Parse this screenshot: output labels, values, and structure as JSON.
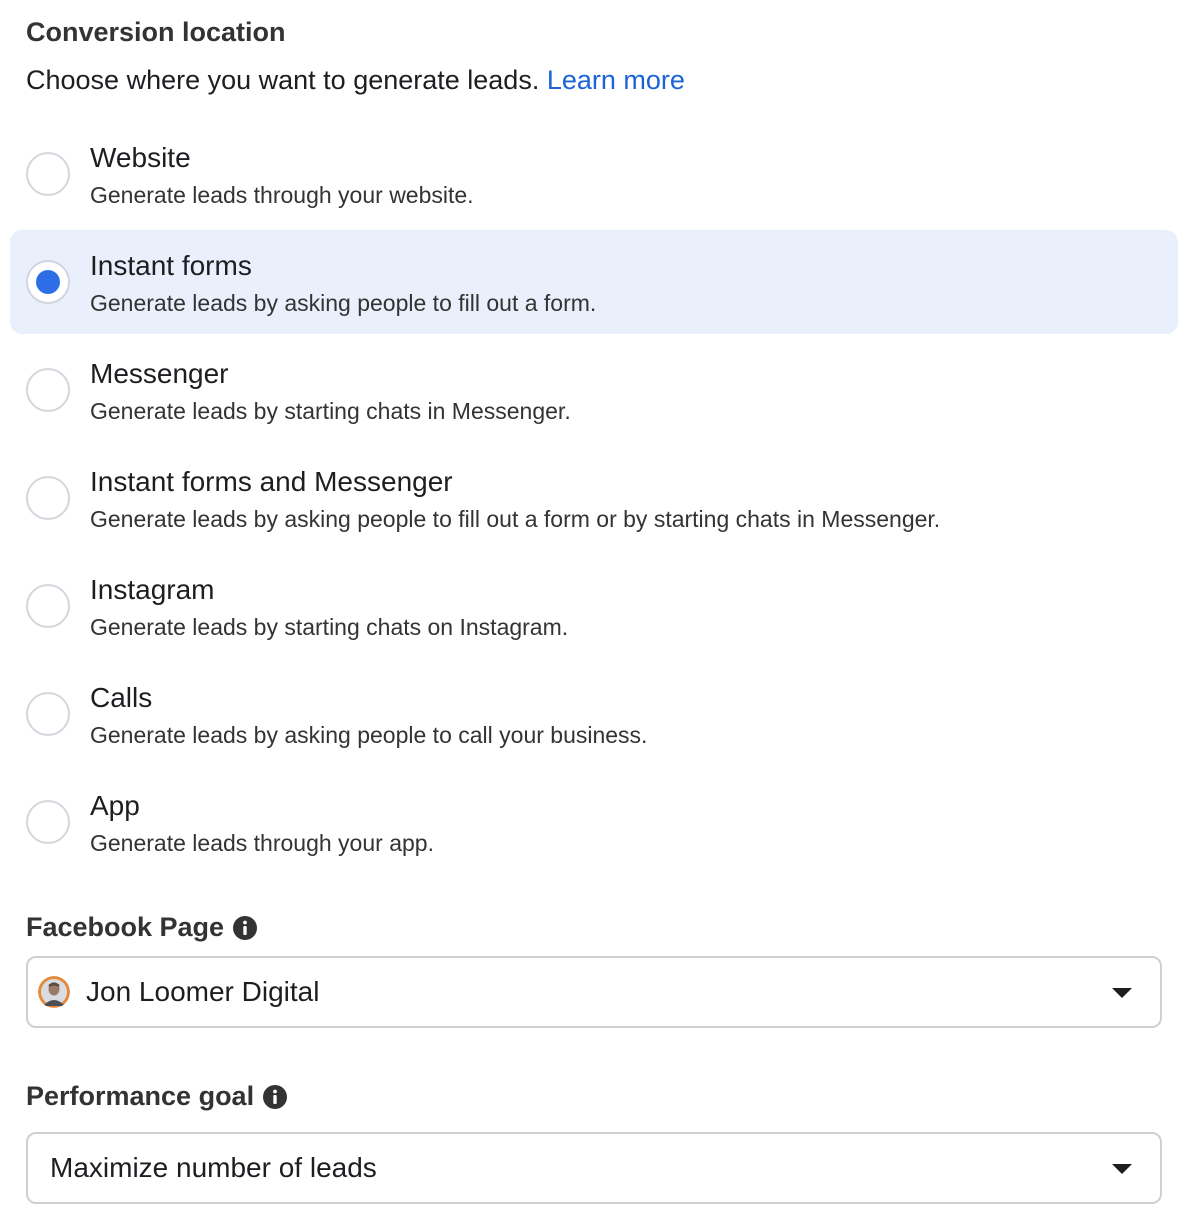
{
  "conversion": {
    "title": "Conversion location",
    "description": "Choose where you want to generate leads.",
    "learn_more": "Learn more",
    "options": [
      {
        "title": "Website",
        "description": "Generate leads through your website."
      },
      {
        "title": "Instant forms",
        "description": "Generate leads by asking people to fill out a form."
      },
      {
        "title": "Messenger",
        "description": "Generate leads by starting chats in Messenger."
      },
      {
        "title": "Instant forms and Messenger",
        "description": "Generate leads by asking people to fill out a form or by starting chats in Messenger."
      },
      {
        "title": "Instagram",
        "description": "Generate leads by starting chats on Instagram."
      },
      {
        "title": "Calls",
        "description": "Generate leads by asking people to call your business."
      },
      {
        "title": "App",
        "description": "Generate leads through your app."
      }
    ],
    "selected_option": "Instant forms"
  },
  "facebook_page": {
    "label": "Facebook Page",
    "selected": "Jon Loomer Digital"
  },
  "performance_goal": {
    "label": "Performance goal",
    "selected": "Maximize number of leads"
  },
  "colors": {
    "accent": "#2d6ee6",
    "link": "#1a64d8",
    "selected_bg": "#e9f0fc"
  }
}
